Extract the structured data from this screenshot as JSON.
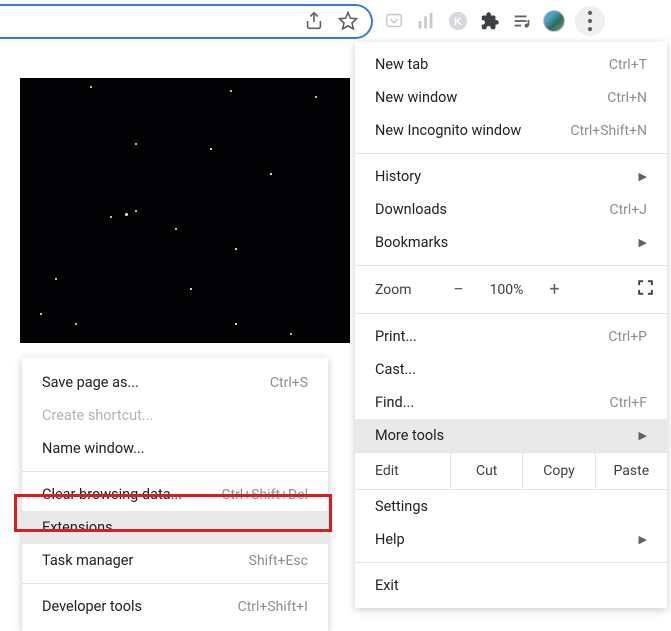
{
  "toolbar": {
    "icons": {
      "share": "share-icon",
      "bookmark_star": "star-icon",
      "pocket": "pocket-icon",
      "analytics": "analytics-icon",
      "k_ext": "k-circle-icon",
      "extensions": "puzzle-icon",
      "reading_list": "playlist-icon",
      "avatar": "profile-avatar",
      "menu_dots": "menu-dots-icon"
    }
  },
  "menu": {
    "new_tab": {
      "label": "New tab",
      "shortcut": "Ctrl+T"
    },
    "new_window": {
      "label": "New window",
      "shortcut": "Ctrl+N"
    },
    "new_incognito": {
      "label": "New Incognito window",
      "shortcut": "Ctrl+Shift+N"
    },
    "history": {
      "label": "History"
    },
    "downloads": {
      "label": "Downloads",
      "shortcut": "Ctrl+J"
    },
    "bookmarks": {
      "label": "Bookmarks"
    },
    "zoom": {
      "label": "Zoom",
      "minus": "−",
      "value": "100%",
      "plus": "+",
      "fullscreen_title": "Full screen"
    },
    "print": {
      "label": "Print...",
      "shortcut": "Ctrl+P"
    },
    "cast": {
      "label": "Cast..."
    },
    "find": {
      "label": "Find...",
      "shortcut": "Ctrl+F"
    },
    "more_tools": {
      "label": "More tools"
    },
    "edit": {
      "label": "Edit",
      "cut": "Cut",
      "copy": "Copy",
      "paste": "Paste"
    },
    "settings": {
      "label": "Settings"
    },
    "help": {
      "label": "Help"
    },
    "exit": {
      "label": "Exit"
    }
  },
  "submenu": {
    "save_page": {
      "label": "Save page as...",
      "shortcut": "Ctrl+S"
    },
    "create_shortcut": {
      "label": "Create shortcut..."
    },
    "name_window": {
      "label": "Name window..."
    },
    "clear_browsing": {
      "label": "Clear browsing data...",
      "shortcut": "Ctrl+Shift+Del"
    },
    "extensions": {
      "label": "Extensions"
    },
    "task_manager": {
      "label": "Task manager",
      "shortcut": "Shift+Esc"
    },
    "developer_tools": {
      "label": "Developer tools",
      "shortcut": "Ctrl+Shift+I"
    }
  }
}
